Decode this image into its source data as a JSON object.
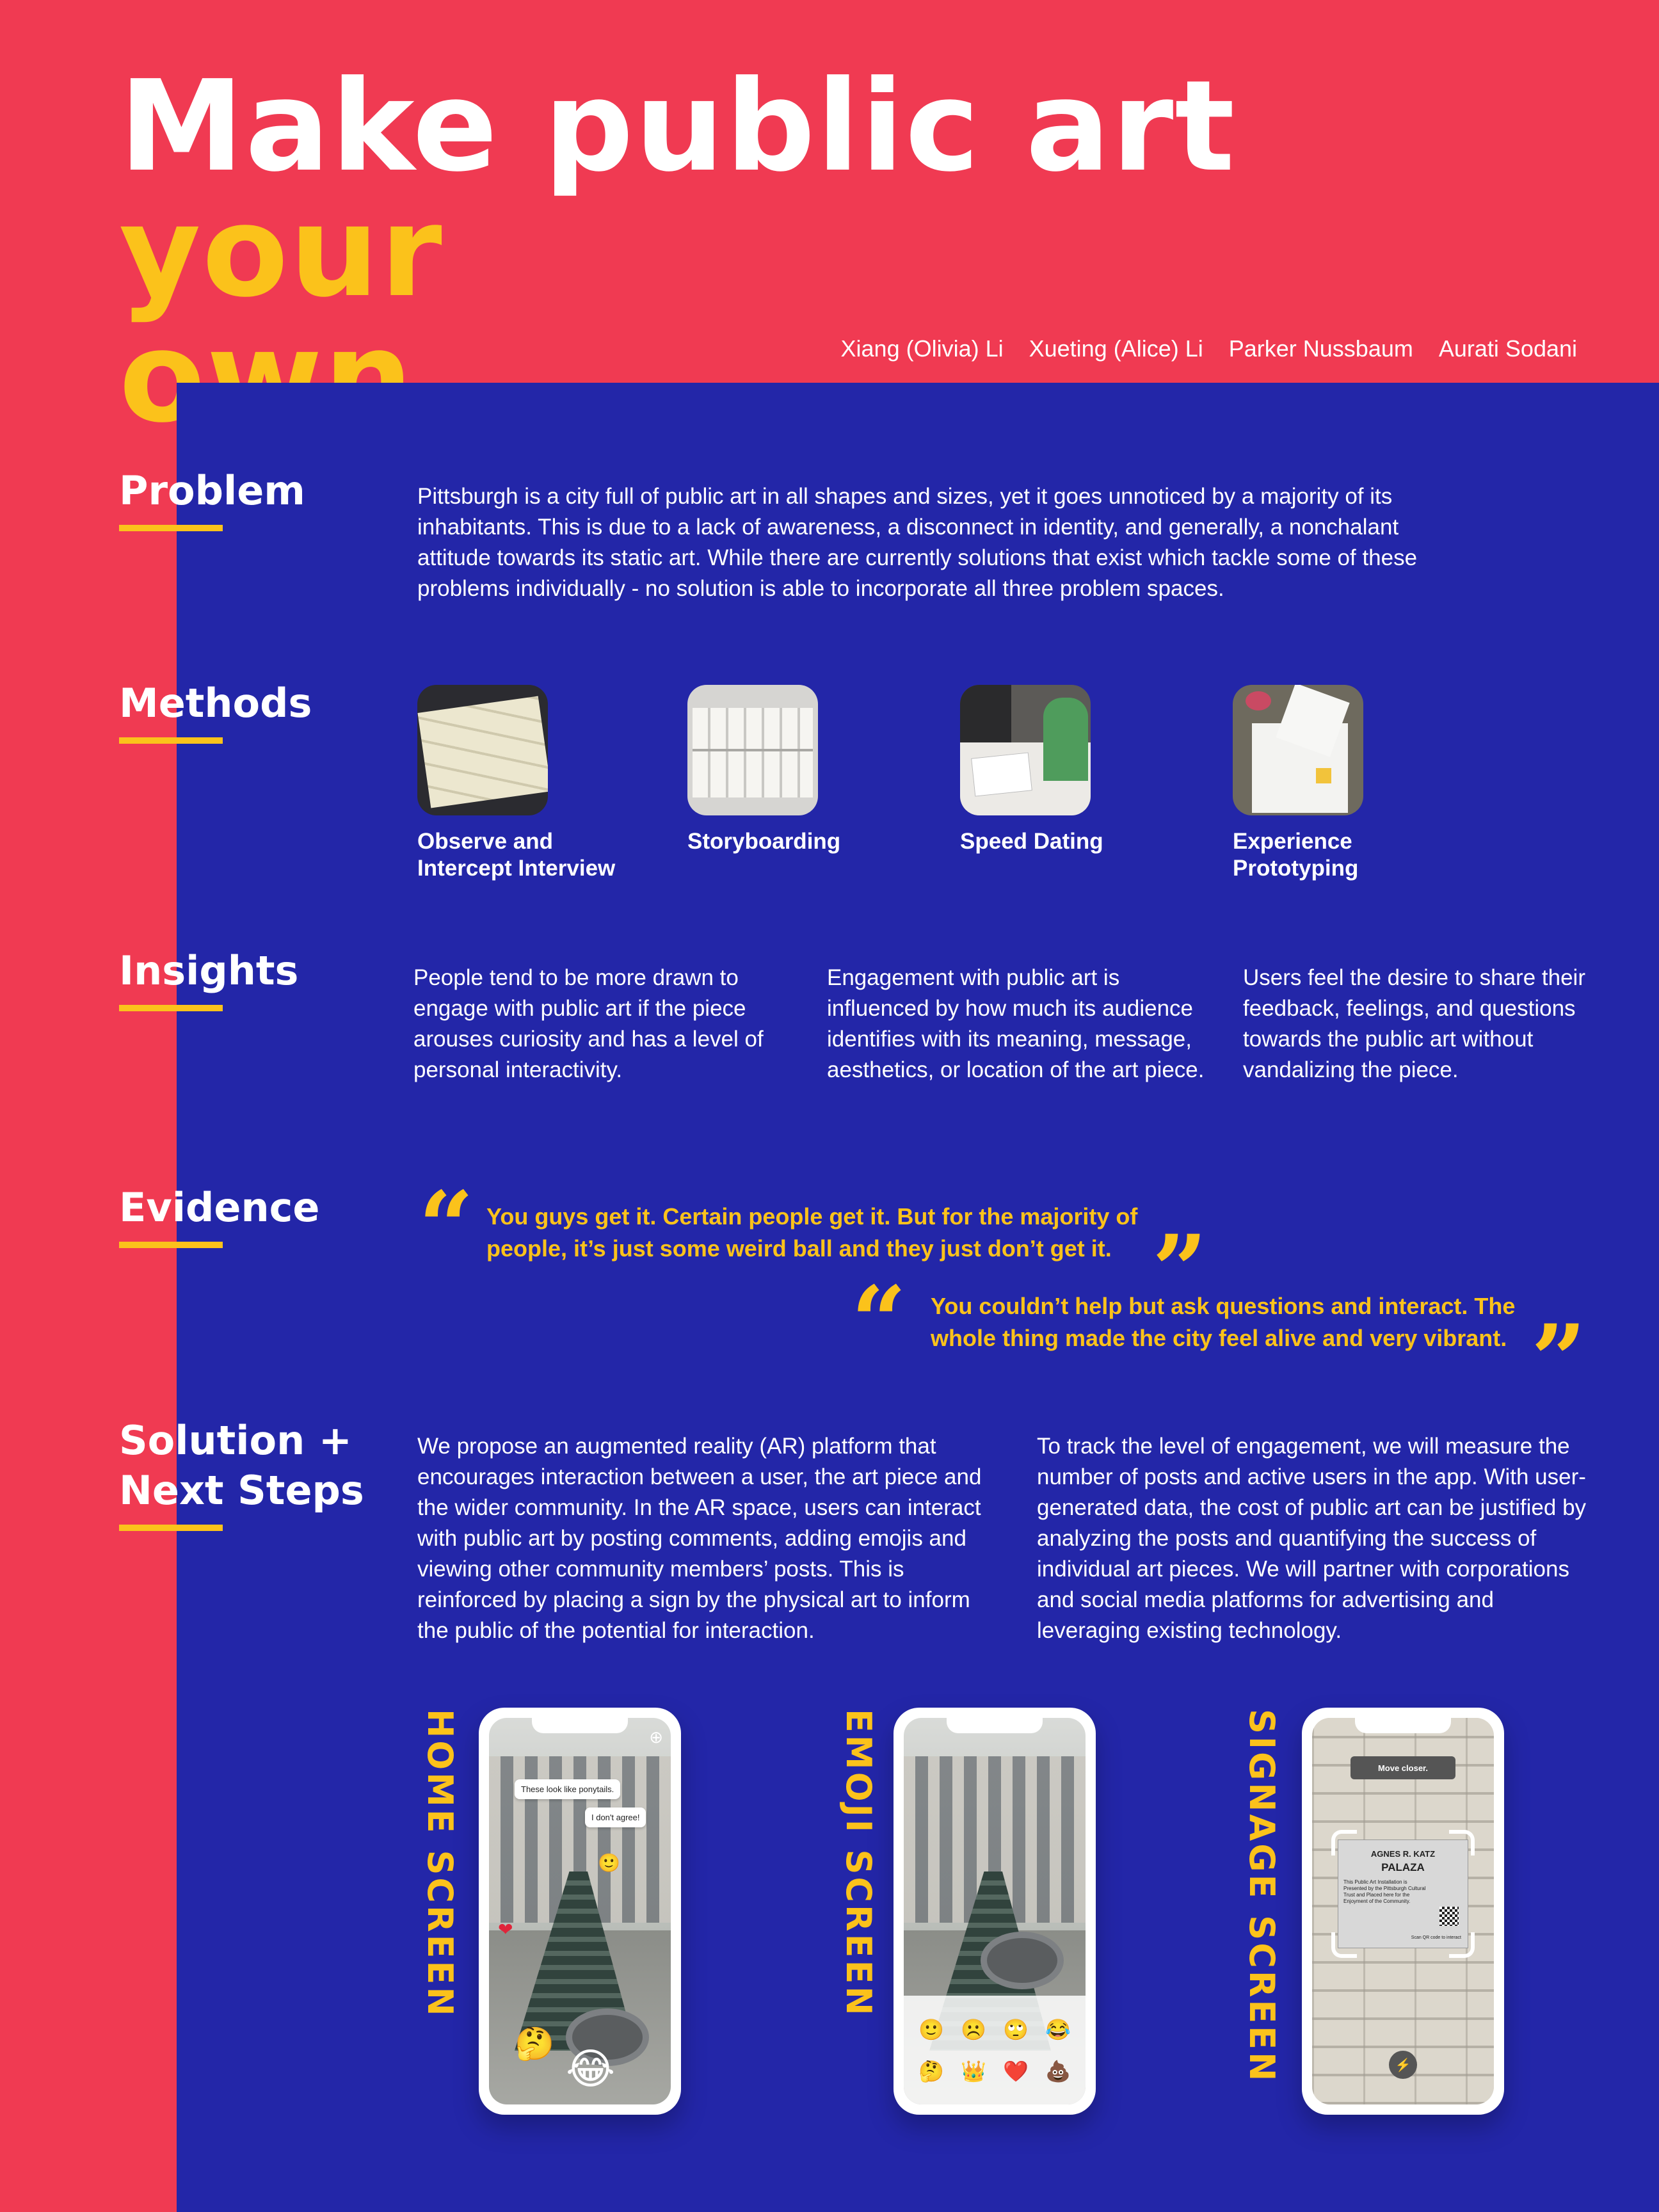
{
  "header": {
    "title_white": "Make public art ",
    "title_yellow_1": "your",
    "title_yellow_2": "own."
  },
  "authors": [
    "Xiang (Olivia) Li",
    "Xueting (Alice) Li",
    "Parker Nussbaum",
    "Aurati Sodani"
  ],
  "problem": {
    "label": "Problem",
    "text": "Pittsburgh is a city full of public art in all shapes and sizes, yet it goes unnoticed by a majority of its inhabitants. This is due to a lack of awareness, a disconnect in identity, and generally, a nonchalant attitude towards its static art. While there are currently solutions that exist which tackle some of these problems individually - no solution is able to incorporate all three problem spaces."
  },
  "methods": {
    "label": "Methods",
    "items": [
      {
        "line1": "Observe and",
        "line2": "Intercept Interview"
      },
      {
        "line1": "Storyboarding",
        "line2": ""
      },
      {
        "line1": "Speed Dating",
        "line2": ""
      },
      {
        "line1": "Experience",
        "line2": "Prototyping"
      }
    ]
  },
  "insights": {
    "label": "Insights",
    "items": [
      "People tend to be more drawn to engage with public art if the piece arouses curiosity and has a level of personal interactivity.",
      "Engagement with public art is influenced by how much its audience identifies with its meaning, message, aesthetics, or location of the art piece.",
      "Users feel the desire to share their feedback, feelings, and questions towards the public art without vandalizing the piece."
    ]
  },
  "evidence": {
    "label": "Evidence",
    "quotes": [
      "You guys get it. Certain people get it. But for the majority of people, it’s just some weird ball and they just don’t get it.",
      "You couldn’t help but ask questions and interact. The whole thing made the city feel alive and very vibrant."
    ]
  },
  "solution": {
    "label_1": "Solution +",
    "label_2": "Next Steps",
    "text_1": "We propose an augmented reality (AR) platform that encourages interaction between a user, the art piece and the wider community. In the AR space, users can interact with public art by posting comments, adding emojis and viewing other community members’ posts. This is reinforced by placing a sign by the physical art to inform the public of the potential for interaction.",
    "text_2": "To track the level of engagement, we will measure the number of posts and active users in the app. With user-generated data, the cost of public art can be justified by analyzing the posts and quantifying the success of individual art pieces. We will partner with corporations and social media platforms for advertising and leveraging existing technology."
  },
  "screens": {
    "home": {
      "label": "HOME SCREEN",
      "comment_1": "These look like ponytails.",
      "comment_2": "I don't agree!"
    },
    "emoji": {
      "label": "EMOJI SCREEN",
      "emojis": [
        "🙂",
        "☹️",
        "🙄",
        "😂",
        "🤔",
        "👑",
        "❤️",
        "💩"
      ]
    },
    "signage": {
      "label": "SIGNAGE SCREEN",
      "toast": "Move closer.",
      "plaque_name": "AGNES R. KATZ",
      "plaque_title": "PALAZA",
      "plaque_desc": "This Public Art Installation is Presented by the Pittsburgh Cultural Trust and Placed here for the Enjoyment of the Community.",
      "plaque_scan": "Scan QR code to interact"
    }
  },
  "colors": {
    "background": "#F03A52",
    "panel": "#2326A8",
    "accent": "#FBC21B"
  }
}
